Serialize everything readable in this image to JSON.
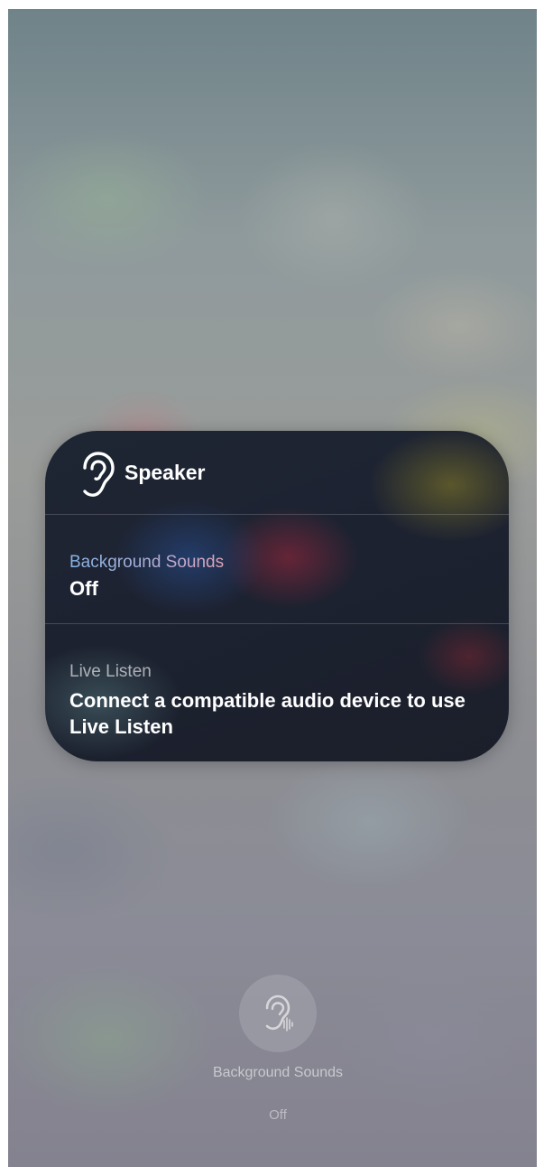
{
  "panel": {
    "title": "Speaker",
    "icon": "ear-icon",
    "background_sounds": {
      "label": "Background Sounds",
      "value": "Off"
    },
    "live_listen": {
      "label": "Live Listen",
      "value": "Connect a compatible audio device to use Live Listen"
    }
  },
  "control": {
    "icon": "ear-sound-icon",
    "label": "Background Sounds",
    "status": "Off"
  }
}
